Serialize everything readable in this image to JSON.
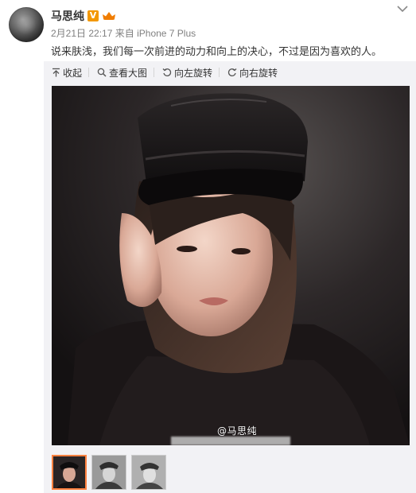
{
  "post": {
    "author": "马思纯",
    "timestamp": "2月21日 22:17",
    "source_prefix": "来自",
    "source": "iPhone 7 Plus",
    "text": "说来肤浅，我们每一次前进的动力和向上的决心，不过是因为喜欢的人。"
  },
  "toolbar": {
    "collapse_label": "收起",
    "view_large_label": "查看大图",
    "rotate_left_label": "向左旋转",
    "rotate_right_label": "向右旋转"
  },
  "photo": {
    "watermark": "@马思纯"
  },
  "thumbnails": {
    "count": 3,
    "selected_index": 0
  },
  "colors": {
    "username": "#333333",
    "meta": "#808080",
    "verified_badge": "#f39800",
    "member_badge": "#f07d00",
    "thumbnail_selected_border": "#ff8140",
    "panel_background": "#f2f2f5"
  },
  "icons": [
    "avatar",
    "verified-badge-icon",
    "member-badge-icon",
    "chevron-down-icon",
    "collapse-icon",
    "magnify-icon",
    "rotate-left-icon",
    "rotate-right-icon"
  ]
}
